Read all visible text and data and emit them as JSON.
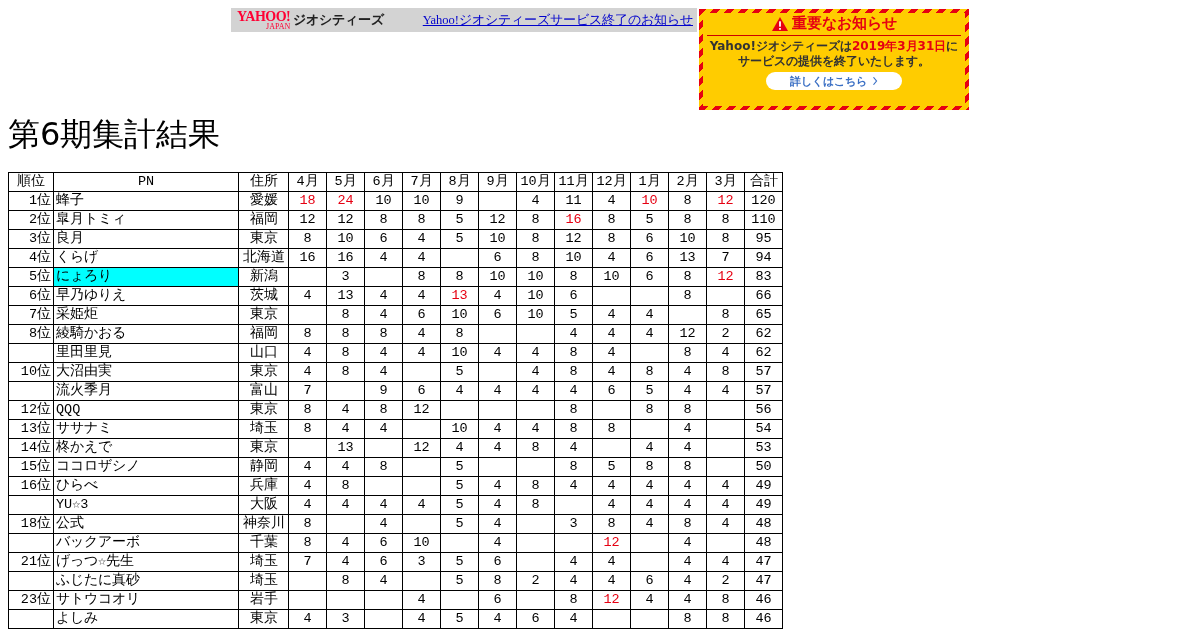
{
  "banner": {
    "logo": "YAHOO!",
    "logo_sub": "JAPAN",
    "service": "ジオシティーズ",
    "link": "Yahoo!ジオシティーズサービス終了のお知らせ"
  },
  "notice": {
    "title": "重要なお知らせ",
    "message_before": "Yahoo!ジオシティーズは",
    "message_date": "2019年3月31日",
    "message_after": "にサービスの提供を終了いたします。",
    "button": "詳しくはこちら"
  },
  "heading": "第6期集計結果",
  "table": {
    "columns": [
      "順位",
      "PN",
      "住所",
      "4月",
      "5月",
      "6月",
      "7月",
      "8月",
      "9月",
      "10月",
      "11月",
      "12月",
      "1月",
      "2月",
      "3月",
      "合計"
    ],
    "rows": [
      {
        "rank": "1位",
        "name": "蜂子",
        "highlight": false,
        "place": "愛媛",
        "months": [
          {
            "kind": "score",
            "v": "18",
            "red": true
          },
          {
            "kind": "score",
            "v": "24",
            "red": true
          },
          {
            "kind": "score",
            "v": "10",
            "red": false
          },
          {
            "kind": "score",
            "v": "10",
            "red": false
          },
          {
            "kind": "score",
            "v": "9",
            "red": false
          },
          {
            "kind": "empty"
          },
          {
            "kind": "score",
            "v": "4",
            "red": false
          },
          {
            "kind": "score",
            "v": "11",
            "red": false
          },
          {
            "kind": "score",
            "v": "4",
            "red": false
          },
          {
            "kind": "score",
            "v": "10",
            "red": true
          },
          {
            "kind": "score",
            "v": "8",
            "red": false
          },
          {
            "kind": "score",
            "v": "12",
            "red": true
          }
        ],
        "total": "120"
      },
      {
        "rank": "2位",
        "name": "皐月トミィ",
        "highlight": false,
        "place": "福岡",
        "months": [
          {
            "kind": "score",
            "v": "12",
            "red": false
          },
          {
            "kind": "score",
            "v": "12",
            "red": false
          },
          {
            "kind": "score",
            "v": "8",
            "red": false
          },
          {
            "kind": "score",
            "v": "8",
            "red": false
          },
          {
            "kind": "score",
            "v": "5",
            "red": false
          },
          {
            "kind": "score",
            "v": "12",
            "red": false
          },
          {
            "kind": "score",
            "v": "8",
            "red": false
          },
          {
            "kind": "score",
            "v": "16",
            "red": true
          },
          {
            "kind": "score",
            "v": "8",
            "red": false
          },
          {
            "kind": "score",
            "v": "5",
            "red": false
          },
          {
            "kind": "score",
            "v": "8",
            "red": false
          },
          {
            "kind": "score",
            "v": "8",
            "red": false
          }
        ],
        "total": "110"
      },
      {
        "rank": "3位",
        "name": "良月",
        "highlight": false,
        "place": "東京",
        "months": [
          {
            "kind": "score",
            "v": "8",
            "red": false
          },
          {
            "kind": "score",
            "v": "10",
            "red": false
          },
          {
            "kind": "score",
            "v": "6",
            "red": false
          },
          {
            "kind": "score",
            "v": "4",
            "red": false
          },
          {
            "kind": "score",
            "v": "5",
            "red": false
          },
          {
            "kind": "score",
            "v": "10",
            "red": false
          },
          {
            "kind": "score",
            "v": "8",
            "red": false
          },
          {
            "kind": "score",
            "v": "12",
            "red": false
          },
          {
            "kind": "score",
            "v": "8",
            "red": false
          },
          {
            "kind": "score",
            "v": "6",
            "red": false
          },
          {
            "kind": "score",
            "v": "10",
            "red": false
          },
          {
            "kind": "score",
            "v": "8",
            "red": false
          }
        ],
        "total": "95"
      },
      {
        "rank": "4位",
        "name": "くらげ",
        "highlight": false,
        "place": "北海道",
        "months": [
          {
            "kind": "score",
            "v": "16",
            "red": false
          },
          {
            "kind": "score",
            "v": "16",
            "red": false
          },
          {
            "kind": "score",
            "v": "4",
            "red": false
          },
          {
            "kind": "score",
            "v": "4",
            "red": false
          },
          {
            "kind": "empty"
          },
          {
            "kind": "score",
            "v": "6",
            "red": false
          },
          {
            "kind": "score",
            "v": "8",
            "red": false
          },
          {
            "kind": "score",
            "v": "10",
            "red": false
          },
          {
            "kind": "score",
            "v": "4",
            "red": false
          },
          {
            "kind": "score",
            "v": "6",
            "red": false
          },
          {
            "kind": "score",
            "v": "13",
            "red": false
          },
          {
            "kind": "score",
            "v": "7",
            "red": false
          }
        ],
        "total": "94"
      },
      {
        "rank": "5位",
        "name": "にょろり",
        "highlight": true,
        "place": "新潟",
        "months": [
          {
            "kind": "empty"
          },
          {
            "kind": "score",
            "v": "3",
            "red": false
          },
          {
            "kind": "empty"
          },
          {
            "kind": "score",
            "v": "8",
            "red": false
          },
          {
            "kind": "score",
            "v": "8",
            "red": false
          },
          {
            "kind": "score",
            "v": "10",
            "red": false
          },
          {
            "kind": "score",
            "v": "10",
            "red": false
          },
          {
            "kind": "score",
            "v": "8",
            "red": false
          },
          {
            "kind": "score",
            "v": "10",
            "red": false
          },
          {
            "kind": "score",
            "v": "6",
            "red": false
          },
          {
            "kind": "score",
            "v": "8",
            "red": false
          },
          {
            "kind": "score",
            "v": "12",
            "red": true
          }
        ],
        "total": "83"
      },
      {
        "rank": "6位",
        "name": "早乃ゆりえ",
        "highlight": false,
        "place": "茨城",
        "months": [
          {
            "kind": "score",
            "v": "4",
            "red": false
          },
          {
            "kind": "score",
            "v": "13",
            "red": false
          },
          {
            "kind": "score",
            "v": "4",
            "red": false
          },
          {
            "kind": "score",
            "v": "4",
            "red": false
          },
          {
            "kind": "score",
            "v": "13",
            "red": true
          },
          {
            "kind": "score",
            "v": "4",
            "red": false
          },
          {
            "kind": "score",
            "v": "10",
            "red": false
          },
          {
            "kind": "score",
            "v": "6",
            "red": false
          },
          {
            "kind": "empty"
          },
          {
            "kind": "empty"
          },
          {
            "kind": "score",
            "v": "8",
            "red": false
          },
          {
            "kind": "empty"
          }
        ],
        "total": "66"
      },
      {
        "rank": "7位",
        "name": "采姫炬",
        "highlight": false,
        "place": "東京",
        "months": [
          {
            "kind": "empty"
          },
          {
            "kind": "score",
            "v": "8",
            "red": false
          },
          {
            "kind": "score",
            "v": "4",
            "red": false
          },
          {
            "kind": "score",
            "v": "6",
            "red": false
          },
          {
            "kind": "score",
            "v": "10",
            "red": false
          },
          {
            "kind": "score",
            "v": "6",
            "red": false
          },
          {
            "kind": "score",
            "v": "10",
            "red": false
          },
          {
            "kind": "score",
            "v": "5",
            "red": false
          },
          {
            "kind": "score",
            "v": "4",
            "red": false
          },
          {
            "kind": "score",
            "v": "4",
            "red": false
          },
          {
            "kind": "empty"
          },
          {
            "kind": "score",
            "v": "8",
            "red": false
          }
        ],
        "total": "65"
      },
      {
        "rank": "8位",
        "name": "綾騎かおる",
        "highlight": false,
        "place": "福岡",
        "months": [
          {
            "kind": "score",
            "v": "8",
            "red": false
          },
          {
            "kind": "score",
            "v": "8",
            "red": false
          },
          {
            "kind": "score",
            "v": "8",
            "red": false
          },
          {
            "kind": "score",
            "v": "4",
            "red": false
          },
          {
            "kind": "score",
            "v": "8",
            "red": false
          },
          {
            "kind": "empty"
          },
          {
            "kind": "empty"
          },
          {
            "kind": "score",
            "v": "4",
            "red": false
          },
          {
            "kind": "score",
            "v": "4",
            "red": false
          },
          {
            "kind": "score",
            "v": "4",
            "red": false
          },
          {
            "kind": "score",
            "v": "12",
            "red": false
          },
          {
            "kind": "score",
            "v": "2",
            "red": false
          }
        ],
        "total": "62"
      },
      {
        "name": "里田里見",
        "highlight": false,
        "place": "山口",
        "months": [
          {
            "kind": "score",
            "v": "4",
            "red": false
          },
          {
            "kind": "score",
            "v": "8",
            "red": false
          },
          {
            "kind": "score",
            "v": "4",
            "red": false
          },
          {
            "kind": "score",
            "v": "4",
            "red": false
          },
          {
            "kind": "score",
            "v": "10",
            "red": false
          },
          {
            "kind": "score",
            "v": "4",
            "red": false
          },
          {
            "kind": "score",
            "v": "4",
            "red": false
          },
          {
            "kind": "score",
            "v": "8",
            "red": false
          },
          {
            "kind": "score",
            "v": "4",
            "red": false
          },
          {
            "kind": "empty"
          },
          {
            "kind": "score",
            "v": "8",
            "red": false
          },
          {
            "kind": "score",
            "v": "4",
            "red": false
          }
        ],
        "total": "62"
      },
      {
        "rank": "10位",
        "name": "大沼由実",
        "highlight": false,
        "place": "東京",
        "months": [
          {
            "kind": "score",
            "v": "4",
            "red": false
          },
          {
            "kind": "score",
            "v": "8",
            "red": false
          },
          {
            "kind": "score",
            "v": "4",
            "red": false
          },
          {
            "kind": "empty"
          },
          {
            "kind": "score",
            "v": "5",
            "red": false
          },
          {
            "kind": "empty"
          },
          {
            "kind": "score",
            "v": "4",
            "red": false
          },
          {
            "kind": "score",
            "v": "8",
            "red": false
          },
          {
            "kind": "score",
            "v": "4",
            "red": false
          },
          {
            "kind": "score",
            "v": "8",
            "red": false
          },
          {
            "kind": "score",
            "v": "4",
            "red": false
          },
          {
            "kind": "score",
            "v": "8",
            "red": false
          }
        ],
        "total": "57"
      },
      {
        "name": "流火季月",
        "highlight": false,
        "place": "富山",
        "months": [
          {
            "kind": "score",
            "v": "7",
            "red": false
          },
          {
            "kind": "empty"
          },
          {
            "kind": "score",
            "v": "9",
            "red": false
          },
          {
            "kind": "score",
            "v": "6",
            "red": false
          },
          {
            "kind": "score",
            "v": "4",
            "red": false
          },
          {
            "kind": "score",
            "v": "4",
            "red": false
          },
          {
            "kind": "score",
            "v": "4",
            "red": false
          },
          {
            "kind": "score",
            "v": "4",
            "red": false
          },
          {
            "kind": "score",
            "v": "6",
            "red": false
          },
          {
            "kind": "score",
            "v": "5",
            "red": false
          },
          {
            "kind": "score",
            "v": "4",
            "red": false
          },
          {
            "kind": "score",
            "v": "4",
            "red": false
          }
        ],
        "total": "57"
      },
      {
        "rank": "12位",
        "name": "QQQ",
        "highlight": false,
        "place": "東京",
        "months": [
          {
            "kind": "score",
            "v": "8",
            "red": false
          },
          {
            "kind": "score",
            "v": "4",
            "red": false
          },
          {
            "kind": "score",
            "v": "8",
            "red": false
          },
          {
            "kind": "score",
            "v": "12",
            "red": false
          },
          {
            "kind": "empty"
          },
          {
            "kind": "empty"
          },
          {
            "kind": "empty"
          },
          {
            "kind": "score",
            "v": "8",
            "red": false
          },
          {
            "kind": "empty"
          },
          {
            "kind": "score",
            "v": "8",
            "red": false
          },
          {
            "kind": "score",
            "v": "8",
            "red": false
          },
          {
            "kind": "empty"
          }
        ],
        "total": "56"
      },
      {
        "rank": "13位",
        "name": "ササナミ",
        "highlight": false,
        "place": "埼玉",
        "months": [
          {
            "kind": "score",
            "v": "8",
            "red": false
          },
          {
            "kind": "score",
            "v": "4",
            "red": false
          },
          {
            "kind": "score",
            "v": "4",
            "red": false
          },
          {
            "kind": "empty"
          },
          {
            "kind": "score",
            "v": "10",
            "red": false
          },
          {
            "kind": "score",
            "v": "4",
            "red": false
          },
          {
            "kind": "score",
            "v": "4",
            "red": false
          },
          {
            "kind": "score",
            "v": "8",
            "red": false
          },
          {
            "kind": "score",
            "v": "8",
            "red": false
          },
          {
            "kind": "empty"
          },
          {
            "kind": "score",
            "v": "4",
            "red": false
          },
          {
            "kind": "empty"
          }
        ],
        "total": "54"
      },
      {
        "rank": "14位",
        "name": "柊かえで",
        "highlight": false,
        "place": "東京",
        "months": [
          {
            "kind": "empty"
          },
          {
            "kind": "score",
            "v": "13",
            "red": false
          },
          {
            "kind": "empty"
          },
          {
            "kind": "score",
            "v": "12",
            "red": false
          },
          {
            "kind": "score",
            "v": "4",
            "red": false
          },
          {
            "kind": "score",
            "v": "4",
            "red": false
          },
          {
            "kind": "score",
            "v": "8",
            "red": false
          },
          {
            "kind": "score",
            "v": "4",
            "red": false
          },
          {
            "kind": "empty"
          },
          {
            "kind": "score",
            "v": "4",
            "red": false
          },
          {
            "kind": "score",
            "v": "4",
            "red": false
          },
          {
            "kind": "empty"
          }
        ],
        "total": "53"
      },
      {
        "rank": "15位",
        "name": "ココロザシノ",
        "highlight": false,
        "place": "静岡",
        "months": [
          {
            "kind": "score",
            "v": "4",
            "red": false
          },
          {
            "kind": "score",
            "v": "4",
            "red": false
          },
          {
            "kind": "score",
            "v": "8",
            "red": false
          },
          {
            "kind": "empty"
          },
          {
            "kind": "score",
            "v": "5",
            "red": false
          },
          {
            "kind": "empty"
          },
          {
            "kind": "empty"
          },
          {
            "kind": "score",
            "v": "8",
            "red": false
          },
          {
            "kind": "score",
            "v": "5",
            "red": false
          },
          {
            "kind": "score",
            "v": "8",
            "red": false
          },
          {
            "kind": "score",
            "v": "8",
            "red": false
          },
          {
            "kind": "empty"
          }
        ],
        "total": "50"
      },
      {
        "rank": "16位",
        "name": "ひらべ",
        "highlight": false,
        "place": "兵庫",
        "months": [
          {
            "kind": "score",
            "v": "4",
            "red": false
          },
          {
            "kind": "score",
            "v": "8",
            "red": false
          },
          {
            "kind": "empty"
          },
          {
            "kind": "empty"
          },
          {
            "kind": "score",
            "v": "5",
            "red": false
          },
          {
            "kind": "score",
            "v": "4",
            "red": false
          },
          {
            "kind": "score",
            "v": "8",
            "red": false
          },
          {
            "kind": "score",
            "v": "4",
            "red": false
          },
          {
            "kind": "score",
            "v": "4",
            "red": false
          },
          {
            "kind": "score",
            "v": "4",
            "red": false
          },
          {
            "kind": "score",
            "v": "4",
            "red": false
          },
          {
            "kind": "score",
            "v": "4",
            "red": false
          }
        ],
        "total": "49"
      },
      {
        "name": "YU☆3",
        "highlight": false,
        "place": "大阪",
        "months": [
          {
            "kind": "score",
            "v": "4",
            "red": false
          },
          {
            "kind": "score",
            "v": "4",
            "red": false
          },
          {
            "kind": "score",
            "v": "4",
            "red": false
          },
          {
            "kind": "score",
            "v": "4",
            "red": false
          },
          {
            "kind": "score",
            "v": "5",
            "red": false
          },
          {
            "kind": "score",
            "v": "4",
            "red": false
          },
          {
            "kind": "score",
            "v": "8",
            "red": false
          },
          {
            "kind": "empty"
          },
          {
            "kind": "score",
            "v": "4",
            "red": false
          },
          {
            "kind": "score",
            "v": "4",
            "red": false
          },
          {
            "kind": "score",
            "v": "4",
            "red": false
          },
          {
            "kind": "score",
            "v": "4",
            "red": false
          }
        ],
        "total": "49"
      },
      {
        "rank": "18位",
        "name": "公式",
        "highlight": false,
        "place": "神奈川",
        "months": [
          {
            "kind": "score",
            "v": "8",
            "red": false
          },
          {
            "kind": "empty"
          },
          {
            "kind": "score",
            "v": "4",
            "red": false
          },
          {
            "kind": "empty"
          },
          {
            "kind": "score",
            "v": "5",
            "red": false
          },
          {
            "kind": "score",
            "v": "4",
            "red": false
          },
          {
            "kind": "empty"
          },
          {
            "kind": "score",
            "v": "3",
            "red": false
          },
          {
            "kind": "score",
            "v": "8",
            "red": false
          },
          {
            "kind": "score",
            "v": "4",
            "red": false
          },
          {
            "kind": "score",
            "v": "8",
            "red": false
          },
          {
            "kind": "score",
            "v": "4",
            "red": false
          }
        ],
        "total": "48"
      },
      {
        "name": "バックアーボ",
        "highlight": false,
        "place": "千葉",
        "months": [
          {
            "kind": "score",
            "v": "8",
            "red": false
          },
          {
            "kind": "score",
            "v": "4",
            "red": false
          },
          {
            "kind": "score",
            "v": "6",
            "red": false
          },
          {
            "kind": "score",
            "v": "10",
            "red": false
          },
          {
            "kind": "empty"
          },
          {
            "kind": "score",
            "v": "4",
            "red": false
          },
          {
            "kind": "empty"
          },
          {
            "kind": "empty"
          },
          {
            "kind": "score",
            "v": "12",
            "red": true
          },
          {
            "kind": "empty"
          },
          {
            "kind": "score",
            "v": "4",
            "red": false
          },
          {
            "kind": "empty"
          }
        ],
        "total": "48"
      },
      {
        "rank": "21位",
        "name": "げっつ☆先生",
        "highlight": false,
        "place": "埼玉",
        "months": [
          {
            "kind": "score",
            "v": "7",
            "red": false
          },
          {
            "kind": "score",
            "v": "4",
            "red": false
          },
          {
            "kind": "score",
            "v": "6",
            "red": false
          },
          {
            "kind": "score",
            "v": "3",
            "red": false
          },
          {
            "kind": "score",
            "v": "5",
            "red": false
          },
          {
            "kind": "score",
            "v": "6",
            "red": false
          },
          {
            "kind": "empty"
          },
          {
            "kind": "score",
            "v": "4",
            "red": false
          },
          {
            "kind": "score",
            "v": "4",
            "red": false
          },
          {
            "kind": "empty"
          },
          {
            "kind": "score",
            "v": "4",
            "red": false
          },
          {
            "kind": "score",
            "v": "4",
            "red": false
          }
        ],
        "total": "47"
      },
      {
        "name": "ふじたに真砂",
        "highlight": false,
        "place": "埼玉",
        "months": [
          {
            "kind": "empty"
          },
          {
            "kind": "score",
            "v": "8",
            "red": false
          },
          {
            "kind": "score",
            "v": "4",
            "red": false
          },
          {
            "kind": "empty"
          },
          {
            "kind": "score",
            "v": "5",
            "red": false
          },
          {
            "kind": "score",
            "v": "8",
            "red": false
          },
          {
            "kind": "score",
            "v": "2",
            "red": false
          },
          {
            "kind": "score",
            "v": "4",
            "red": false
          },
          {
            "kind": "score",
            "v": "4",
            "red": false
          },
          {
            "kind": "score",
            "v": "6",
            "red": false
          },
          {
            "kind": "score",
            "v": "4",
            "red": false
          },
          {
            "kind": "score",
            "v": "2",
            "red": false
          }
        ],
        "total": "47"
      },
      {
        "rank": "23位",
        "name": "サトウコオリ",
        "highlight": false,
        "place": "岩手",
        "months": [
          {
            "kind": "empty"
          },
          {
            "kind": "empty"
          },
          {
            "kind": "empty"
          },
          {
            "kind": "score",
            "v": "4",
            "red": false
          },
          {
            "kind": "empty"
          },
          {
            "kind": "score",
            "v": "6",
            "red": false
          },
          {
            "kind": "empty"
          },
          {
            "kind": "score",
            "v": "8",
            "red": false
          },
          {
            "kind": "score",
            "v": "12",
            "red": true
          },
          {
            "kind": "score",
            "v": "4",
            "red": false
          },
          {
            "kind": "score",
            "v": "4",
            "red": false
          },
          {
            "kind": "score",
            "v": "8",
            "red": false
          }
        ],
        "total": "46"
      },
      {
        "name": "よしみ",
        "highlight": false,
        "place": "東京",
        "months": [
          {
            "kind": "score",
            "v": "4",
            "red": false
          },
          {
            "kind": "score",
            "v": "3",
            "red": false
          },
          {
            "kind": "empty"
          },
          {
            "kind": "score",
            "v": "4",
            "red": false
          },
          {
            "kind": "score",
            "v": "5",
            "red": false
          },
          {
            "kind": "score",
            "v": "4",
            "red": false
          },
          {
            "kind": "score",
            "v": "6",
            "red": false
          },
          {
            "kind": "score",
            "v": "4",
            "red": false
          },
          {
            "kind": "empty"
          },
          {
            "kind": "empty"
          },
          {
            "kind": "score",
            "v": "8",
            "red": false
          },
          {
            "kind": "score",
            "v": "8",
            "red": false
          }
        ],
        "total": "46"
      }
    ]
  }
}
